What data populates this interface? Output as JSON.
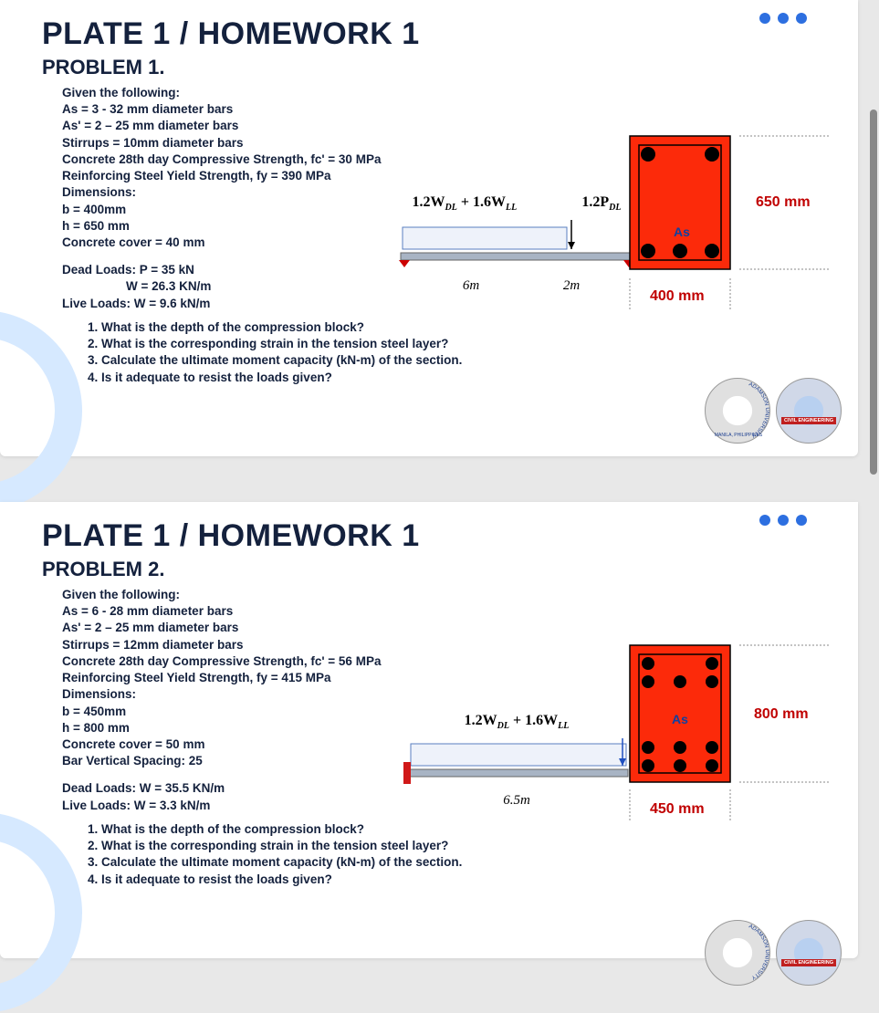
{
  "slide1": {
    "title": "PLATE 1 / HOMEWORK 1",
    "problem": "PROBLEM 1.",
    "given_header": "Given the following:",
    "lines": [
      "As = 3 - 32 mm diameter bars",
      "As' = 2 – 25 mm diameter bars",
      "Stirrups = 10mm diameter bars",
      "Concrete 28th day Compressive Strength, fc' = 30 MPa",
      "Reinforcing Steel Yield Strength, fy = 390 MPa",
      "Dimensions:",
      "b = 400mm",
      "h = 650 mm",
      "Concrete cover = 40 mm"
    ],
    "loads": [
      "Dead Loads:  P = 35 kN",
      "W = 26.3 KN/m",
      "Live Loads: W = 9.6 kN/m"
    ],
    "formula_dist": "1.2W",
    "formula_dist_sub": "DL",
    "formula_plus": " + 1.6W",
    "formula_plus_sub": "LL",
    "formula_point": "1.2P",
    "formula_point_sub": "DL",
    "span1": "6m",
    "span2": "2m",
    "section_width": "400 mm",
    "section_height": "650 mm",
    "section_as": "As",
    "questions": [
      "1.  What is the depth of the compression block?",
      "2. What is the corresponding strain in the tension steel layer?",
      "3. Calculate the ultimate moment capacity (kN-m) of the section.",
      "4.  Is it adequate to resist the loads given?"
    ],
    "seal1_top": "ADAMSON UNIVERSITY",
    "seal1_bottom": "MANILA, PHILIPPINES",
    "seal2_band": "CIVIL ENGINEERING"
  },
  "slide2": {
    "title": "PLATE 1 / HOMEWORK 1",
    "problem": "PROBLEM 2.",
    "given_header": "Given the following:",
    "lines": [
      "As = 6 - 28 mm diameter bars",
      "As' = 2 – 25 mm diameter bars",
      "Stirrups = 12mm diameter bars",
      "Concrete 28th day Compressive Strength, fc' = 56 MPa",
      "Reinforcing Steel Yield Strength, fy = 415 MPa",
      "Dimensions:",
      "b = 450mm",
      "h = 800 mm",
      "Concrete cover = 50 mm",
      "Bar Vertical Spacing: 25"
    ],
    "loads": [
      "Dead Loads:  W = 35.5 KN/m",
      "Live Loads: W = 3.3 kN/m"
    ],
    "formula_dist": "1.2W",
    "formula_dist_sub": "DL",
    "formula_plus": " + 1.6W",
    "formula_plus_sub": "LL",
    "span1": "6.5m",
    "section_width": "450 mm",
    "section_height": "800 mm",
    "section_as": "As",
    "questions": [
      "1.  What is the depth of the compression block?",
      "2. What is the corresponding strain in the tension steel layer?",
      "3. Calculate the ultimate moment capacity (kN-m) of the section.",
      "4.  Is it adequate to resist the loads given?"
    ],
    "seal1_top": "ADAMSON UNIVERSITY",
    "seal2_band": "CIVIL ENGINEERING"
  }
}
